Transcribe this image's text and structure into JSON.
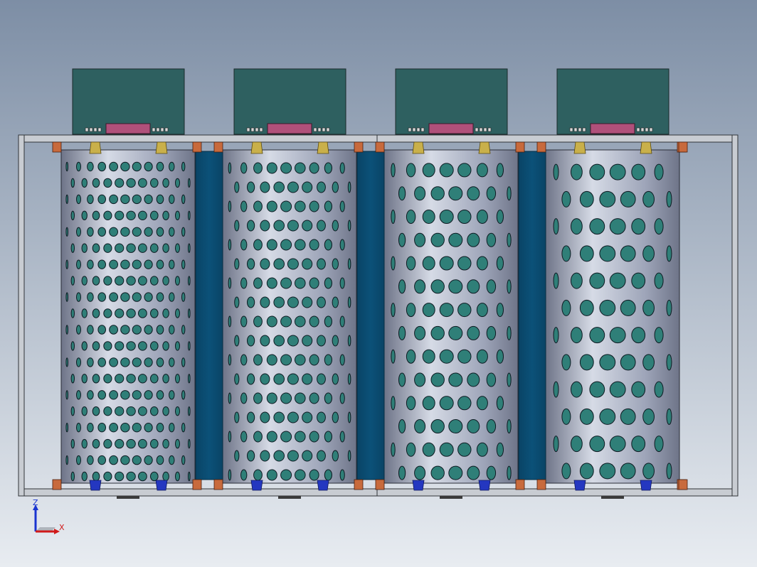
{
  "viewport": {
    "background_top": "#7d8ea5",
    "background_bottom": "#e8ecf1"
  },
  "colors": {
    "control_box": "#2e6060",
    "control_box_edge": "#1a2a2a",
    "display_panel": "#b0507a",
    "frame": "#c8ccd2",
    "frame_edge": "#303338",
    "cylinder_light": "#d6dbe6",
    "cylinder_mid": "#9da4b8",
    "cylinder_dark": "#6e7488",
    "hole_fill": "#2f7f78",
    "separator_panel": "#0b5178",
    "top_connector": "#c9b04a",
    "bottom_connector": "#2437c0",
    "clamp": "#c86a3c",
    "foot": "#3a3a3a"
  },
  "modules": [
    {
      "id": "module-1",
      "hole_rows": 20,
      "hole_cols": 11
    },
    {
      "id": "module-2",
      "hole_rows": 17,
      "hole_cols": 9
    },
    {
      "id": "module-3",
      "hole_rows": 14,
      "hole_cols": 7
    },
    {
      "id": "module-4",
      "hole_rows": 12,
      "hole_cols": 6
    }
  ],
  "triad": {
    "z_label": "Z",
    "x_label": "X",
    "z_color": "#1a35d0",
    "x_color": "#d01a1a"
  }
}
